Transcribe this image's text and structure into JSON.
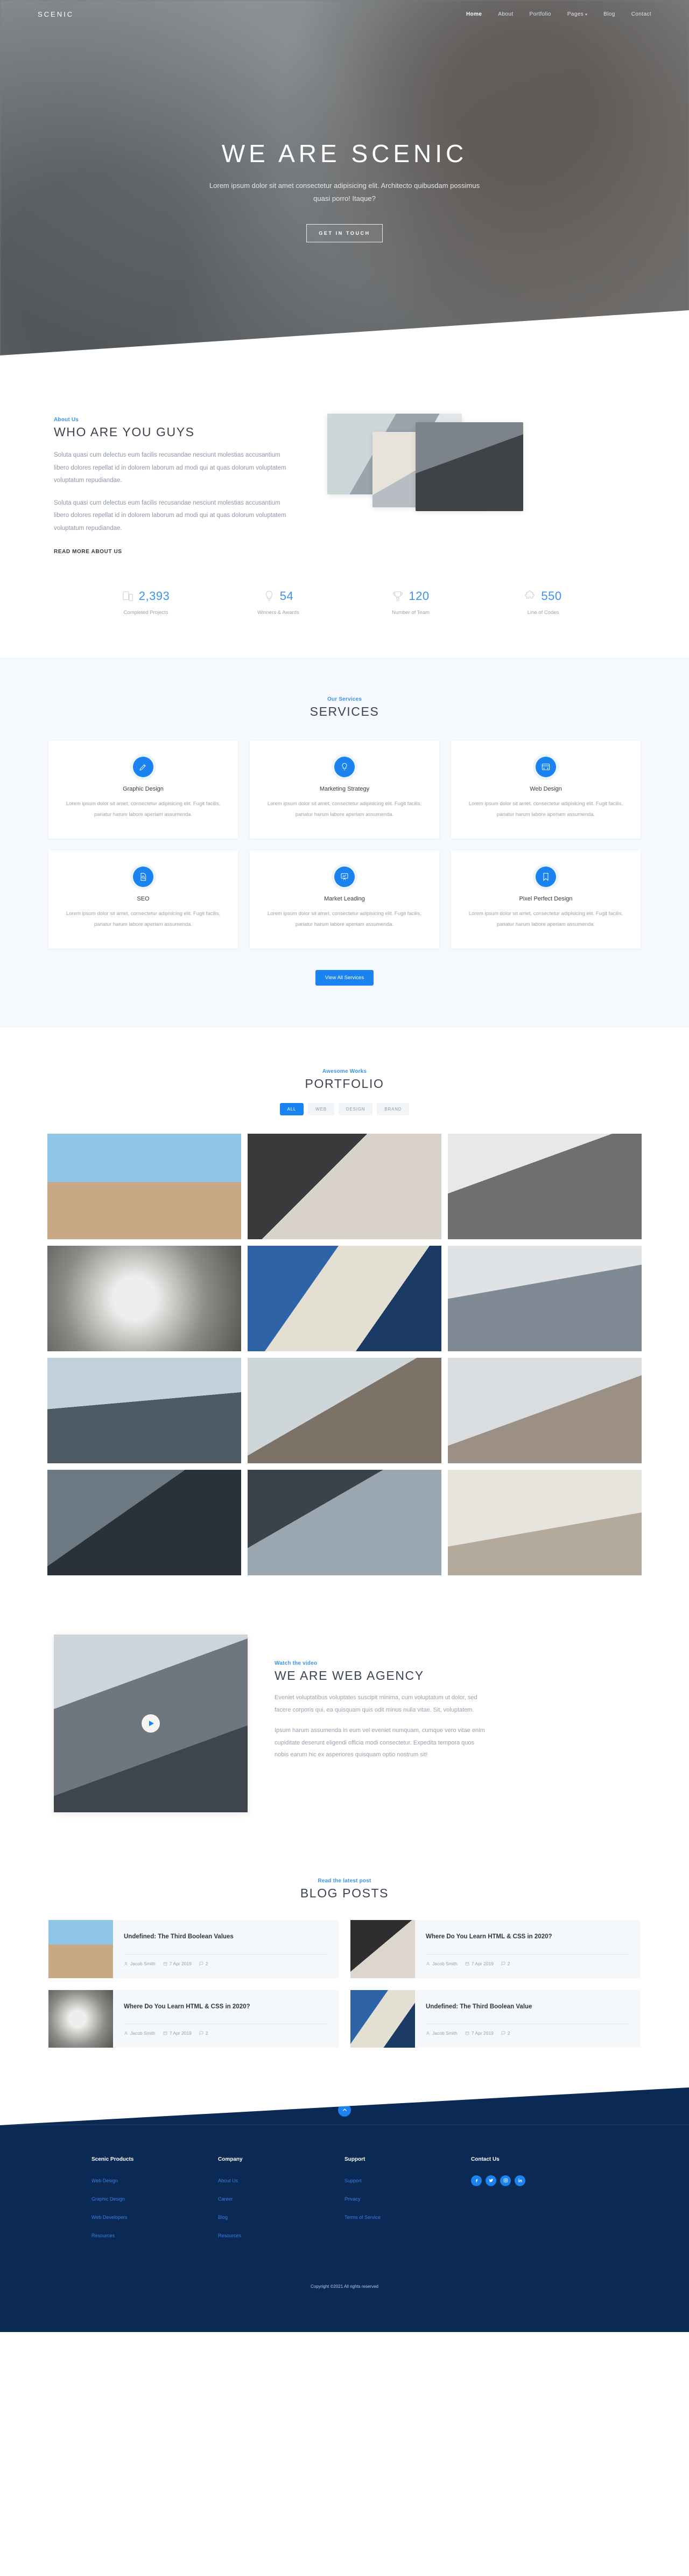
{
  "brand": "SCENIC",
  "nav": {
    "items": [
      {
        "label": "Home",
        "active": true
      },
      {
        "label": "About",
        "active": false
      },
      {
        "label": "Portfolio",
        "active": false
      },
      {
        "label": "Pages",
        "active": false,
        "caret": "▾"
      },
      {
        "label": "Blog",
        "active": false
      },
      {
        "label": "Contact",
        "active": false
      }
    ]
  },
  "hero": {
    "title": "WE ARE SCENIC",
    "subtitle": "Lorem ipsum dolor sit amet consectetur adipisicing elit. Architecto quibusdam possimus quasi porro! Itaque?",
    "cta": "GET IN TOUCH",
    "scroll_icon": "chevron-down-icon"
  },
  "about": {
    "kicker": "About Us",
    "title": "WHO ARE YOU GUYS",
    "paragraph1": "Soluta quasi cum delectus eum facilis recusandae nesciunt molestias accusantium libero dolores repellat id in dolorem laborum ad modi qui at quas dolorum voluptatem voluptatum repudiandae.",
    "paragraph2": "Soluta quasi cum delectus eum facilis recusandae nesciunt molestias accusantium libero dolores repellat id in dolorem laborum ad modi qui at quas dolorum voluptatem voluptatum repudiandae.",
    "readmore": "READ MORE ABOUT US"
  },
  "stats": [
    {
      "icon": "mobile-icon",
      "value": "2,393",
      "label": "Completed Projects"
    },
    {
      "icon": "lightbulb-icon",
      "value": "54",
      "label": "Winners & Awards"
    },
    {
      "icon": "trophy-icon",
      "value": "120",
      "label": "Number of Team"
    },
    {
      "icon": "puzzle-icon",
      "value": "550",
      "label": "Line of Codes"
    }
  ],
  "services": {
    "kicker": "Our Services",
    "title": "SERVICES",
    "cta": "View All Services",
    "cards": [
      {
        "icon": "pencil-ruler-icon",
        "name": "Graphic Design",
        "desc": "Lorem ipsum dolor sit amet, consectetur adipisicing elit. Fugit facilis, pariatur harum labore aperiam assumenda."
      },
      {
        "icon": "lightbulb-icon",
        "name": "Marketing Strategy",
        "desc": "Lorem ipsum dolor sit amet, consectetur adipisicing elit. Fugit facilis, pariatur harum labore aperiam assumenda."
      },
      {
        "icon": "code-window-icon",
        "name": "Web Design",
        "desc": "Lorem ipsum dolor sit amet, consectetur adipisicing elit. Fugit facilis, pariatur harum labore aperiam assumenda."
      },
      {
        "icon": "document-search-icon",
        "name": "SEO",
        "desc": "Lorem ipsum dolor sit amet, consectetur adipisicing elit. Fugit facilis, pariatur harum labore aperiam assumenda."
      },
      {
        "icon": "presentation-chart-icon",
        "name": "Market Leading",
        "desc": "Lorem ipsum dolor sit amet, consectetur adipisicing elit. Fugit facilis, pariatur harum labore aperiam assumenda."
      },
      {
        "icon": "bookmark-icon",
        "name": "Pixel Perfect Design",
        "desc": "Lorem ipsum dolor sit amet, consectetur adipisicing elit. Fugit facilis, pariatur harum labore aperiam assumenda."
      }
    ]
  },
  "portfolio": {
    "kicker": "Awesome Works",
    "title": "PORTFOLIO",
    "filters": [
      {
        "label": "ALL",
        "active": true
      },
      {
        "label": "WEB",
        "active": false
      },
      {
        "label": "DESIGN",
        "active": false
      },
      {
        "label": "BRAND",
        "active": false
      }
    ],
    "items": [
      {
        "name": "portfolio-item-1"
      },
      {
        "name": "portfolio-item-2"
      },
      {
        "name": "portfolio-item-3"
      },
      {
        "name": "portfolio-item-4"
      },
      {
        "name": "portfolio-item-5"
      },
      {
        "name": "portfolio-item-6"
      },
      {
        "name": "portfolio-item-7"
      },
      {
        "name": "portfolio-item-8"
      },
      {
        "name": "portfolio-item-9"
      },
      {
        "name": "portfolio-item-10"
      },
      {
        "name": "portfolio-item-11"
      },
      {
        "name": "portfolio-item-12"
      }
    ]
  },
  "agency": {
    "kicker": "Watch the video",
    "title": "WE ARE WEB AGENCY",
    "paragraph1": "Eveniet voluptatibus voluptates suscipit minima, cum voluptatum ut dolor, sed facere corporis qui, ea quisquam quis odit minus nulla vitae. Sit, voluptatem.",
    "paragraph2": "Ipsum harum assumenda in eum vel eveniet numquam, cumque vero vitae enim cupiditate deserunt eligendi officia modi consectetur. Expedita tempora quos nobis earum hic ex asperiores quisquam optio nostrum sit!",
    "play_icon": "play-icon"
  },
  "blog": {
    "kicker": "Read the latest post",
    "title": "BLOG POSTS",
    "posts": [
      {
        "title": "Undefined: The Third Boolean Values",
        "author": "Jacob Smith",
        "date": "7 Apr 2019",
        "comments": "2"
      },
      {
        "title": "Where Do You Learn HTML & CSS in 2020?",
        "author": "Jacob Smith",
        "date": "7 Apr 2019",
        "comments": "2"
      },
      {
        "title": "Where Do You Learn HTML & CSS in 2020?",
        "author": "Jacob Smith",
        "date": "7 Apr 2019",
        "comments": "2"
      },
      {
        "title": "Undefined: The Third Boolean Value",
        "author": "Jacob Smith",
        "date": "7 Apr 2019",
        "comments": "2"
      }
    ],
    "meta_icons": {
      "author": "user-icon",
      "date": "calendar-icon",
      "comments": "comment-icon"
    }
  },
  "footer": {
    "scroll_icon": "chevron-up-icon",
    "columns": [
      {
        "heading": "Scenic Products",
        "links": [
          "Web Design",
          "Graphic Design",
          "Web Developers",
          "Resources"
        ]
      },
      {
        "heading": "Company",
        "links": [
          "About Us",
          "Career",
          "Blog",
          "Resources"
        ]
      },
      {
        "heading": "Support",
        "links": [
          "Support",
          "Privacy",
          "Terms of Service"
        ]
      }
    ],
    "contact_heading": "Contact Us",
    "socials": [
      {
        "name": "facebook-icon",
        "glyph": "f"
      },
      {
        "name": "twitter-icon",
        "glyph": "🐦"
      },
      {
        "name": "instagram-icon",
        "glyph": "◙"
      },
      {
        "name": "linkedin-icon",
        "glyph": "in"
      }
    ],
    "copyright": "Copyright ©2021 All rights reserved"
  },
  "colors": {
    "accent": "#1a83f0",
    "kicker": "#3c93ec",
    "footer_bg": "#0a2a55",
    "services_bg": "#f5f9fd"
  }
}
